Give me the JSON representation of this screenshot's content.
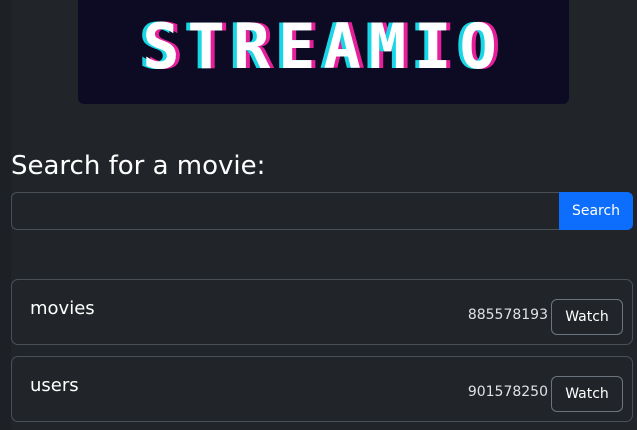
{
  "logo": {
    "text": "STREAMIO"
  },
  "search": {
    "heading": "Search for a movie:",
    "input_value": "",
    "placeholder": "",
    "button_label": "Search"
  },
  "results": [
    {
      "title": "movies",
      "number": "885578193",
      "action_label": "Watch"
    },
    {
      "title": "users",
      "number": "901578250",
      "action_label": "Watch"
    }
  ],
  "colors": {
    "background": "#212529",
    "accent": "#0d6efd",
    "logo_background": "#0d0b24",
    "logo_cyan": "#17d7e6",
    "logo_magenta": "#e6209b"
  }
}
